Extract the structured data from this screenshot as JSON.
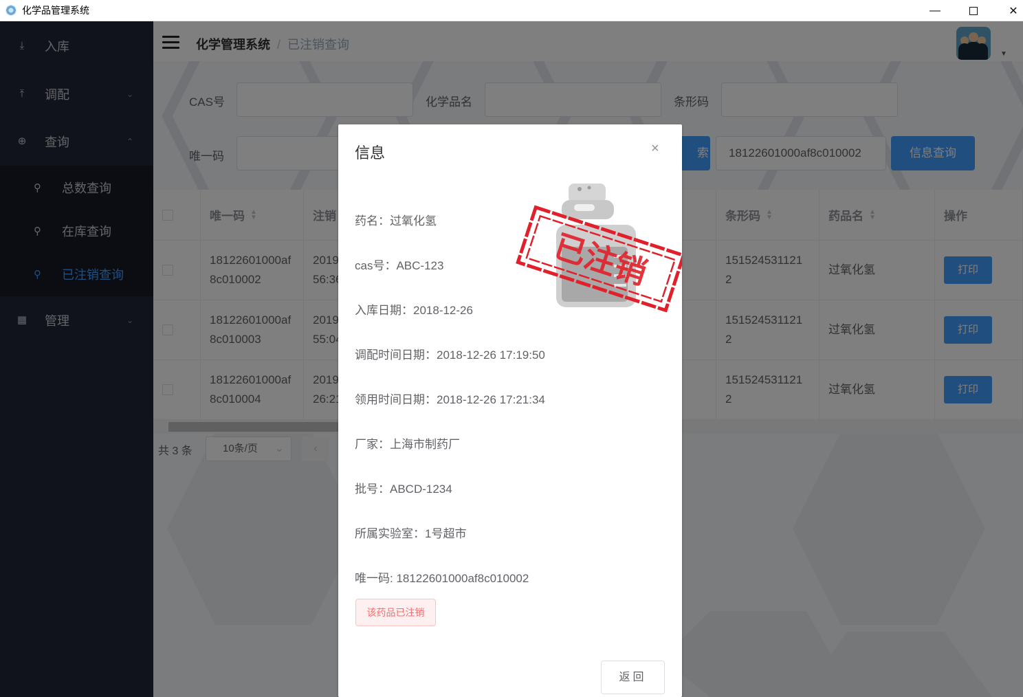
{
  "window": {
    "title": "化学品管理系统",
    "minimize": "—",
    "close": "✕"
  },
  "sidebar": {
    "items": [
      {
        "label": "入库",
        "icon": "import-icon"
      },
      {
        "label": "调配",
        "icon": "export-icon",
        "arrow": "⌄"
      },
      {
        "label": "查询",
        "icon": "zoom-icon",
        "arrow": "⌃"
      },
      {
        "label": "管理",
        "icon": "grid-icon",
        "arrow": "⌄"
      }
    ],
    "sub": [
      {
        "label": "总数查询"
      },
      {
        "label": "在库查询"
      },
      {
        "label": "已注销查询"
      }
    ]
  },
  "header": {
    "breadcrumb_root": "化学管理系统",
    "breadcrumb_sep": "/",
    "breadcrumb_current": "已注销查询"
  },
  "filters": {
    "cas_label": "CAS号",
    "name_label": "化学品名",
    "barcode_label": "条形码",
    "unique_label": "唯一码",
    "search_btn": "索",
    "unique_value": "18122601000af8c010002",
    "info_btn": "信息查询"
  },
  "table": {
    "headers": [
      "唯一码",
      "注销",
      "条形码",
      "药品名",
      "操作"
    ],
    "rows": [
      {
        "uid1": "18122601000af",
        "uid2": "8c010002",
        "date1": "2019",
        "date2": "56:36",
        "bc1": "151524531121",
        "bc2": "2",
        "name": "过氧化氢",
        "action": "打印"
      },
      {
        "uid1": "18122601000af",
        "uid2": "8c010003",
        "date1": "2019",
        "date2": "55:04",
        "bc1": "151524531121",
        "bc2": "2",
        "name": "过氧化氢",
        "action": "打印"
      },
      {
        "uid1": "18122601000af",
        "uid2": "8c010004",
        "date1": "2019",
        "date2": "26:21",
        "bc1": "151524531121",
        "bc2": "2",
        "name": "过氧化氢",
        "action": "打印"
      }
    ]
  },
  "pager": {
    "total": "共 3 条",
    "size": "10条/页",
    "prev": "‹"
  },
  "dialog": {
    "title": "信息",
    "close": "×",
    "fields": [
      "药名：过氧化氢",
      "cas号：ABC-123",
      "入库日期：2018-12-26",
      "调配时间日期：2018-12-26 17:19:50",
      "领用时间日期：2018-12-26 17:21:34",
      "厂家：上海市制药厂",
      "批号：ABCD-1234",
      "所属实验室：1号超市",
      "唯一码: 18122601000af8c010002"
    ],
    "tag": "该药品已注销",
    "stamp_text": "已注销",
    "back_btn": "返回"
  },
  "colors": {
    "sidebar": "#212736",
    "primary": "#409eff",
    "danger": "#f56c6c"
  }
}
